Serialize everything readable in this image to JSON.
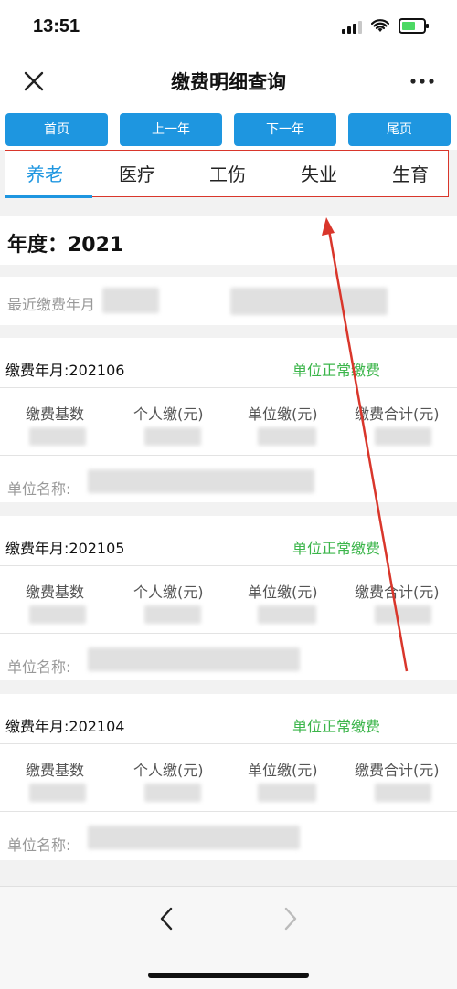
{
  "status": {
    "time": "13:51"
  },
  "header": {
    "title": "缴费明细查询"
  },
  "nav_buttons": {
    "first": "首页",
    "prev_year": "上一年",
    "next_year": "下一年",
    "last": "尾页"
  },
  "tabs": [
    "养老",
    "医疗",
    "工伤",
    "失业",
    "生育"
  ],
  "year": "年度：2021",
  "recent_label": "最近缴费年月",
  "columns": [
    "缴费基数",
    "个人缴(元)",
    "单位缴(元)",
    "缴费合计(元)"
  ],
  "unit_name_label": "单位名称:",
  "records": [
    {
      "month": "缴费年月:202106",
      "status": "单位正常缴费"
    },
    {
      "month": "缴费年月:202105",
      "status": "单位正常缴费"
    },
    {
      "month": "缴费年月:202104",
      "status": "单位正常缴费"
    }
  ],
  "colors": {
    "accent": "#1e96e0",
    "status_green": "#3bb54a",
    "annotation_red": "#d9362b"
  },
  "icons": {
    "close": "close-icon",
    "more": "more-icon",
    "back": "chevron-left-icon",
    "forward": "chevron-right-icon"
  }
}
